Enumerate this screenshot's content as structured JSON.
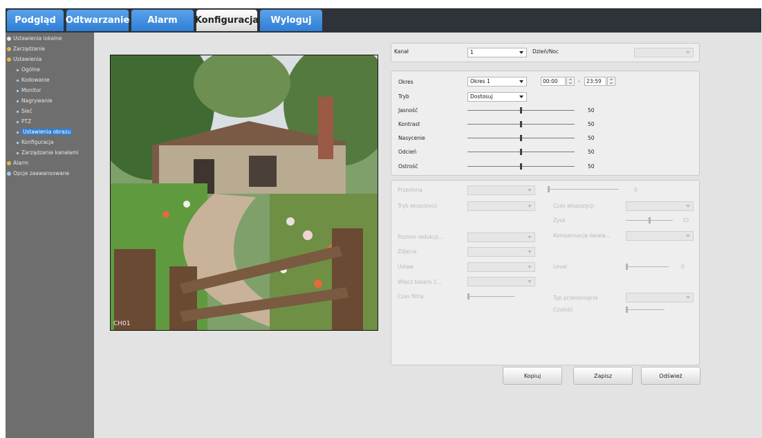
{
  "tabs": [
    {
      "label": "Podgląd"
    },
    {
      "label": "Odtwarzanie"
    },
    {
      "label": "Alarm"
    },
    {
      "label": "Konfiguracja",
      "active": true
    },
    {
      "label": "Wyloguj"
    }
  ],
  "sidebar": {
    "items": [
      {
        "label": "Ustawienia lokalne",
        "level": 0,
        "icon": "computer-icon"
      },
      {
        "label": "Zarządzanie",
        "level": 0,
        "icon": "management-icon"
      },
      {
        "label": "Ustawienia",
        "level": 0,
        "icon": "settings-icon"
      },
      {
        "label": "Ogólne",
        "level": 1
      },
      {
        "label": "Kodowanie",
        "level": 1
      },
      {
        "label": "Monitor",
        "level": 1
      },
      {
        "label": "Nagrywanie",
        "level": 1
      },
      {
        "label": "Sieć",
        "level": 1
      },
      {
        "label": "PTZ",
        "level": 1
      },
      {
        "label": "Ustawienia obrazu",
        "level": 1,
        "selected": true
      },
      {
        "label": "Konfiguracja",
        "level": 1
      },
      {
        "label": "Zarządzanie kanałami",
        "level": 1
      },
      {
        "label": "Alarm",
        "level": 0,
        "icon": "alarm-icon"
      },
      {
        "label": "Opcje zaawansowane",
        "level": 0,
        "icon": "advanced-icon"
      }
    ]
  },
  "preview": {
    "channel_overlay": "CH01"
  },
  "channel_panel": {
    "kanal_label": "Kanał",
    "kanal_value": "1",
    "dzien_noc_label": "Dzień/Noc",
    "dzien_noc_value": ""
  },
  "image_panel": {
    "okres_label": "Okres",
    "okres_value": "Okres 1",
    "time_start": "00:00",
    "time_sep": "-",
    "time_end": "23:59",
    "tryb_label": "Tryb",
    "tryb_value": "Dostosuj",
    "sliders": [
      {
        "label": "Jasność",
        "value": "50",
        "level": 0.5
      },
      {
        "label": "Kontrast",
        "value": "50",
        "level": 0.5
      },
      {
        "label": "Nasycenie",
        "value": "50",
        "level": 0.5
      },
      {
        "label": "Odcień",
        "value": "50",
        "level": 0.5
      },
      {
        "label": "Ostrość",
        "value": "50",
        "level": 0.5
      }
    ]
  },
  "advanced_panel": {
    "przeslona_label": "Przesłona",
    "przeslona_value": "0",
    "tryb_ekspozycji_label": "Tryb ekspozycji",
    "czas_ekspozycji_label": "Czas ekspozycji",
    "zysk_label": "Zysk",
    "zysk_value": "15",
    "poziom_redukcji_label": "Poziom redukcji...",
    "kompensacja_label": "Kompensacja świała...",
    "zdjecia_label": "Zdjęcia",
    "ustaw_label": "Ustaw",
    "level_label": "Level",
    "level_value": "0",
    "wlacz_label": "Włącz balans 1...",
    "czas_filtra_label": "Czas filtra",
    "typ_przeslony_label": "Typ przesłonięcia",
    "czulosc_label": "Czułość"
  },
  "buttons": {
    "copy": "Kopiuj",
    "save": "Zapisz",
    "refresh": "Odśwież"
  }
}
